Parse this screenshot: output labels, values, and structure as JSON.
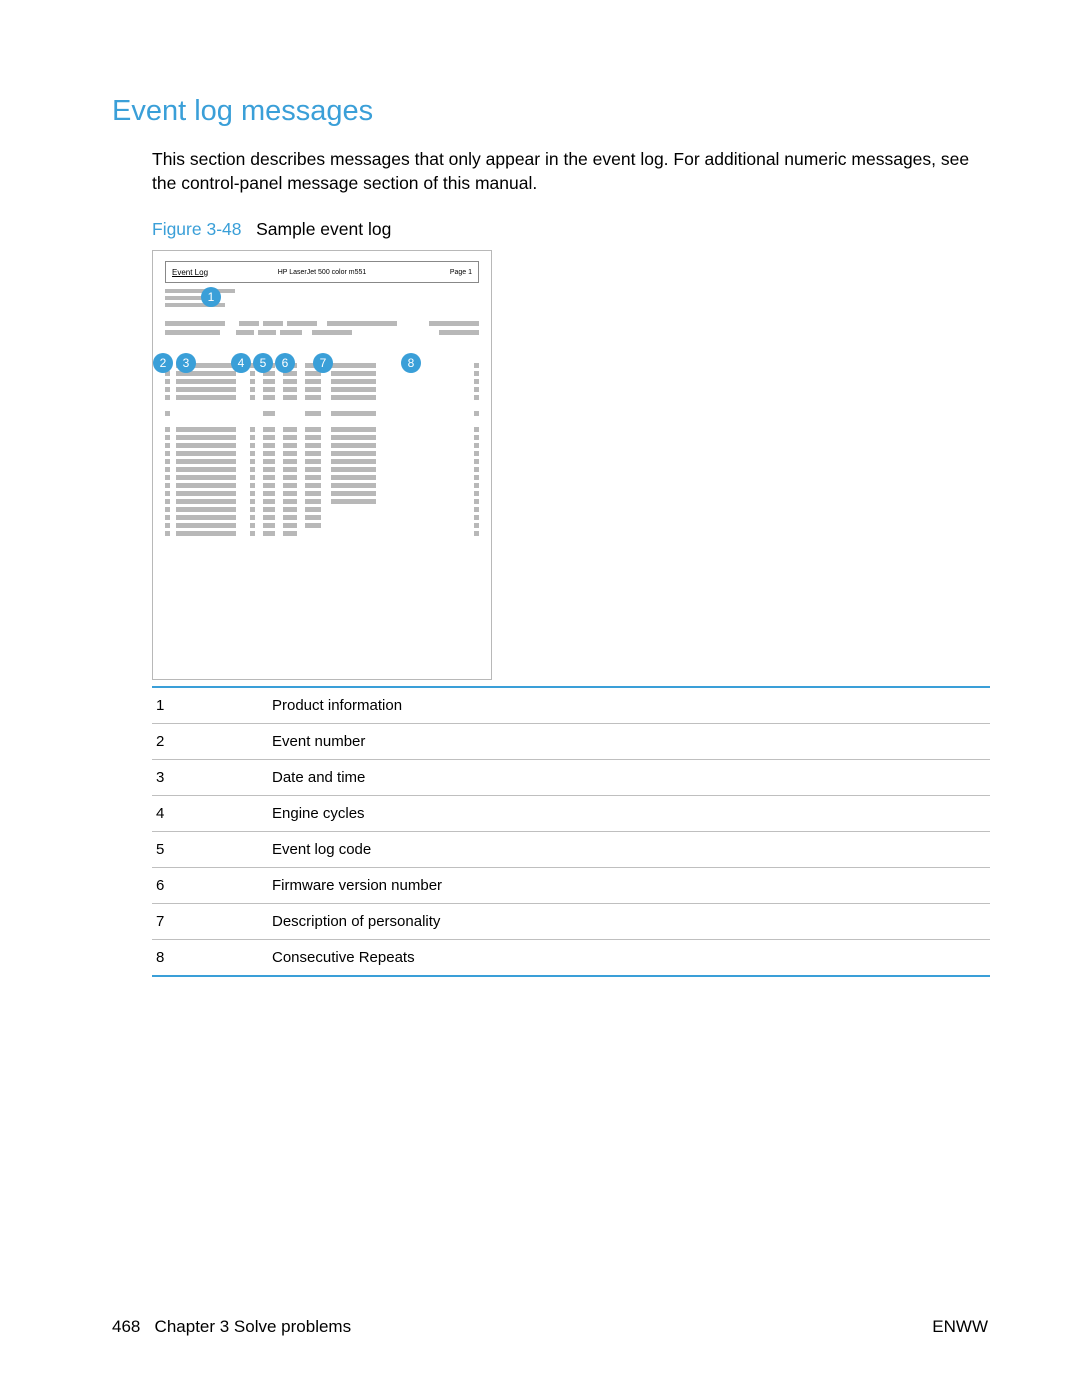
{
  "heading": "Event log messages",
  "intro": "This section describes messages that only appear in the event log. For additional numeric messages, see the control-panel message section of this manual.",
  "figure": {
    "number": "Figure 3-48",
    "title": "Sample event log",
    "eventlog_label": "Event Log",
    "product": "HP LaserJet 500 color m551",
    "page_label": "Page 1",
    "callouts": [
      "1",
      "2",
      "3",
      "4",
      "5",
      "6",
      "7",
      "8"
    ]
  },
  "legend": [
    {
      "n": "1",
      "t": "Product information"
    },
    {
      "n": "2",
      "t": "Event number"
    },
    {
      "n": "3",
      "t": "Date and time"
    },
    {
      "n": "4",
      "t": "Engine cycles"
    },
    {
      "n": "5",
      "t": "Event log code"
    },
    {
      "n": "6",
      "t": "Firmware version number"
    },
    {
      "n": "7",
      "t": "Description of personality"
    },
    {
      "n": "8",
      "t": "Consecutive Repeats"
    }
  ],
  "footer": {
    "page_number": "468",
    "chapter": "Chapter 3   Solve problems",
    "right": "ENWW"
  }
}
